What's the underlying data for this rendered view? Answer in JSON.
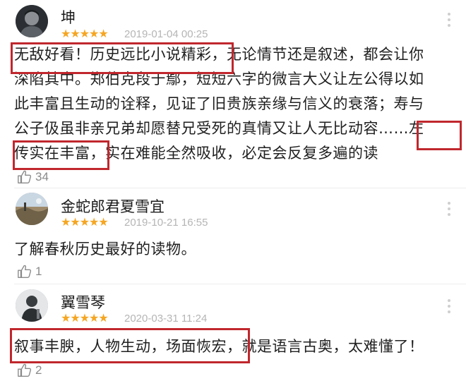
{
  "reviews": [
    {
      "username": "坤",
      "stars": "★★★★★",
      "date": "2019-01-04 00:25",
      "lines": [
        "无敌好看！历史远比小说精彩，无论情节还是叙述，都会让你",
        "深陷其中。郑伯克段于鄢，短短六字的微言大义让左公得以如",
        "此丰富且生动的诠释，见证了旧贵族亲缘与信义的衰落；寿与",
        "公子伋虽非亲兄弟却愿替兄受死的真情又让人无比动容……左",
        "传实在丰富，实在难能全然吸收，必定会反复多遍的读"
      ],
      "likes": "34"
    },
    {
      "username": "金蛇郎君夏雪宜",
      "stars": "★★★★★",
      "date": "2019-10-21 16:55",
      "lines": [
        "了解春秋历史最好的读物。"
      ],
      "likes": "1"
    },
    {
      "username": "翼雪琴",
      "stars": "★★★★★",
      "date": "2020-03-31 11:24",
      "lines": [
        "叙事丰腴，人物生动，场面恢宏，就是语言古奥，太难懂了！"
      ],
      "likes": "2"
    }
  ],
  "colors": {
    "star": "#f5a623",
    "highlight_box": "#c0272d",
    "date": "#b5b5b5"
  },
  "icons": [
    "thumb-up-icon",
    "more-icon",
    "avatar"
  ]
}
